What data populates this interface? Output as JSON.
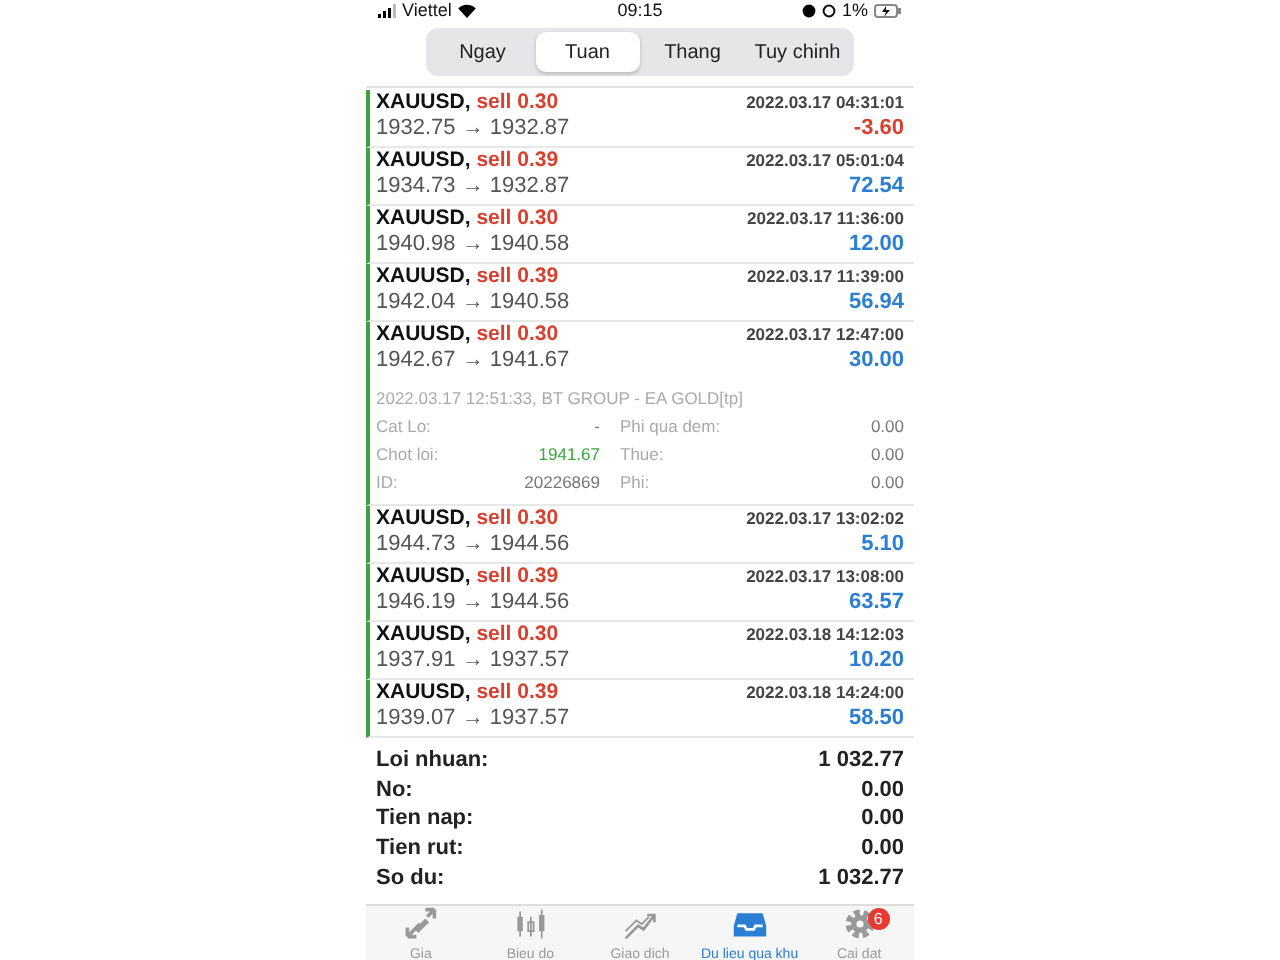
{
  "status_bar": {
    "carrier": "Viettel",
    "time": "09:15",
    "battery": "1%"
  },
  "tabs": [
    {
      "label": "Ngay",
      "selected": false
    },
    {
      "label": "Tuan",
      "selected": true
    },
    {
      "label": "Thang",
      "selected": false
    },
    {
      "label": "Tuy chinh",
      "selected": false
    }
  ],
  "trades": [
    {
      "symbol": "XAUUSD,",
      "side": "sell 0.30",
      "time": "2022.03.17 04:31:01",
      "prices": "1932.75 → 1932.87",
      "profit": "-3.60",
      "loss": true
    },
    {
      "symbol": "XAUUSD,",
      "side": "sell 0.39",
      "time": "2022.03.17 05:01:04",
      "prices": "1934.73 → 1932.87",
      "profit": "72.54",
      "loss": false
    },
    {
      "symbol": "XAUUSD,",
      "side": "sell 0.30",
      "time": "2022.03.17 11:36:00",
      "prices": "1940.98 → 1940.58",
      "profit": "12.00",
      "loss": false
    },
    {
      "symbol": "XAUUSD,",
      "side": "sell 0.39",
      "time": "2022.03.17 11:39:00",
      "prices": "1942.04 → 1940.58",
      "profit": "56.94",
      "loss": false
    },
    {
      "symbol": "XAUUSD,",
      "side": "sell 0.30",
      "time": "2022.03.17 12:47:00",
      "prices": "1942.67 → 1941.67",
      "profit": "30.00",
      "loss": false,
      "details": {
        "comment": "2022.03.17 12:51:33, BT GROUP - EA GOLD[tp]",
        "fields": [
          {
            "label": "Cat Lo:",
            "value": "-",
            "positive": false
          },
          {
            "label": "Phi qua dem:",
            "value": "0.00",
            "positive": false
          },
          {
            "label": "Chot loi:",
            "value": "1941.67",
            "positive": true
          },
          {
            "label": "Thue:",
            "value": "0.00",
            "positive": false
          },
          {
            "label": "ID:",
            "value": "20226869",
            "positive": false
          },
          {
            "label": "Phi:",
            "value": "0.00",
            "positive": false
          }
        ]
      }
    },
    {
      "symbol": "XAUUSD,",
      "side": "sell 0.30",
      "time": "2022.03.17 13:02:02",
      "prices": "1944.73 → 1944.56",
      "profit": "5.10",
      "loss": false
    },
    {
      "symbol": "XAUUSD,",
      "side": "sell 0.39",
      "time": "2022.03.17 13:08:00",
      "prices": "1946.19 → 1944.56",
      "profit": "63.57",
      "loss": false
    },
    {
      "symbol": "XAUUSD,",
      "side": "sell 0.30",
      "time": "2022.03.18 14:12:03",
      "prices": "1937.91 → 1937.57",
      "profit": "10.20",
      "loss": false
    },
    {
      "symbol": "XAUUSD,",
      "side": "sell 0.39",
      "time": "2022.03.18 14:24:00",
      "prices": "1939.07 → 1937.57",
      "profit": "58.50",
      "loss": false
    }
  ],
  "summary": [
    {
      "label": "Loi nhuan:",
      "value": "1 032.77"
    },
    {
      "label": "No:",
      "value": "0.00"
    },
    {
      "label": "Tien nap:",
      "value": "0.00"
    },
    {
      "label": "Tien rut:",
      "value": "0.00"
    },
    {
      "label": "So du:",
      "value": "1 032.77"
    }
  ],
  "tab_bar": [
    {
      "kind": "quotes",
      "label": "Gia",
      "selected": false
    },
    {
      "kind": "chart",
      "label": "Bieu do",
      "selected": false
    },
    {
      "kind": "trade",
      "label": "Giao dich",
      "selected": false
    },
    {
      "kind": "history",
      "label": "Du lieu qua khu",
      "selected": true
    },
    {
      "kind": "settings",
      "label": "Cai dat",
      "selected": false,
      "badge": "6"
    }
  ]
}
